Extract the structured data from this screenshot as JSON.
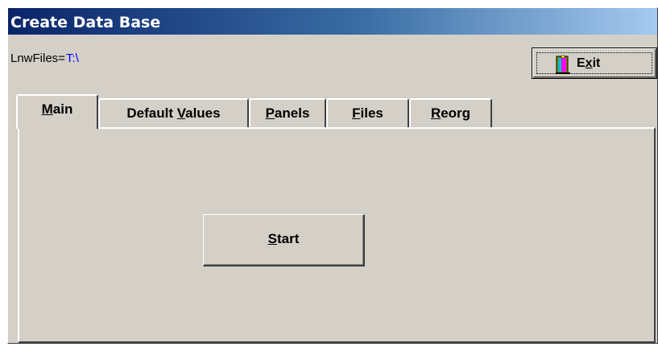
{
  "window": {
    "title": "Create Data Base"
  },
  "files": {
    "label": "LnwFiles=",
    "value": "T:\\"
  },
  "exit_button": {
    "label_prefix": "E",
    "label_mnemonic": "x",
    "label_suffix": "it",
    "icon": "exit-door-icon"
  },
  "tabs": [
    {
      "mnemonic": "M",
      "rest": "ain",
      "prefix": "",
      "active": true
    },
    {
      "prefix": "Default ",
      "mnemonic": "V",
      "rest": "alues",
      "active": false
    },
    {
      "prefix": "",
      "mnemonic": "P",
      "rest": "anels",
      "active": false
    },
    {
      "prefix": "",
      "mnemonic": "F",
      "rest": "iles",
      "active": false
    },
    {
      "prefix": "",
      "mnemonic": "R",
      "rest": "eorg",
      "active": false
    }
  ],
  "main_panel": {
    "start_button": {
      "mnemonic": "S",
      "rest": "tart"
    }
  },
  "colors": {
    "title_gradient_start": "#0a246a",
    "title_gradient_end": "#a6caf0",
    "face": "#d4d0c8",
    "path_value": "#0000ff"
  }
}
